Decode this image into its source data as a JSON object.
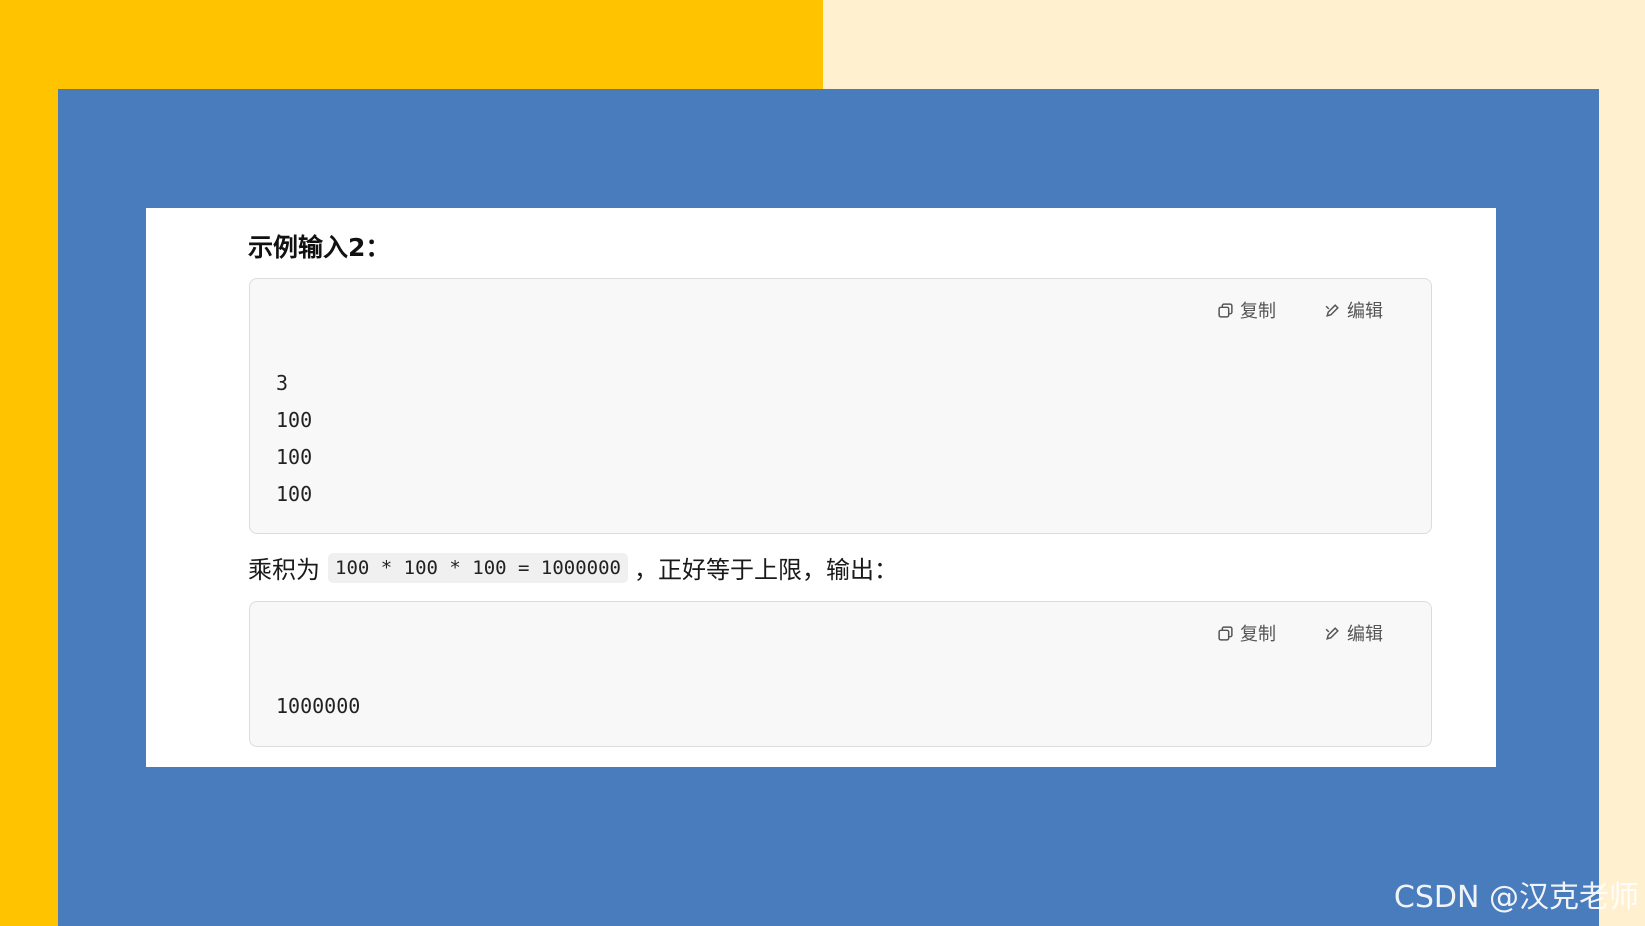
{
  "colors": {
    "yellow": "#ffc300",
    "cream": "#fff1cf",
    "blue": "#487cbd",
    "panel": "#ffffff"
  },
  "heading": "示例输入2：",
  "toolbar": {
    "copy_label": "复制",
    "edit_label": "编辑",
    "copy_icon": "copy-icon",
    "edit_icon": "edit-icon"
  },
  "input_block": {
    "lines": [
      "3",
      "100",
      "100",
      "100"
    ]
  },
  "explanation": {
    "prefix": "乘积为",
    "code": "100 * 100 * 100 = 1000000",
    "suffix": "，正好等于上限，输出："
  },
  "output_block": {
    "lines": [
      "1000000"
    ]
  },
  "watermark": "CSDN @汉克老师"
}
